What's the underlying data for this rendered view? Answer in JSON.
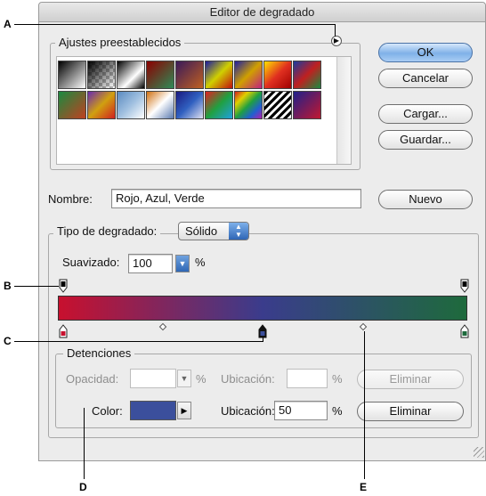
{
  "window": {
    "title": "Editor de degradado"
  },
  "presets": {
    "legend": "Ajustes preestablecidos",
    "swatches": [
      "linear-gradient(135deg,#000,#fff)",
      "linear-gradient(135deg,#000 0%,rgba(0,0,0,0) 100%), repeating-conic-gradient(#bbb 0 25%, #fff 0 50%) 0 0/8px 8px",
      "linear-gradient(135deg,#000,#fff 60%,#000)",
      "linear-gradient(135deg,#8b0000,#2e8b57)",
      "linear-gradient(135deg,#3a1a5a,#c06020)",
      "linear-gradient(135deg,#1a1aa0,#d0d000,#c01010)",
      "linear-gradient(135deg,#2020a0,#d0a000,#c02080)",
      "linear-gradient(135deg,#ffe000,#e03020,#a00000)",
      "linear-gradient(135deg,#1a3aa0,#c02020,#1a8a40)",
      "linear-gradient(135deg,#1a8a40,#c04020)",
      "linear-gradient(135deg,#6a2ab0,#d0a010,#d02020)",
      "linear-gradient(135deg,#5a8ac0,#a0c0e0,#fff)",
      "linear-gradient(135deg,#d07010,#fff 50%,#5a7ab0)",
      "linear-gradient(135deg,#1a1a80,#3060c0,#e0e0f0)",
      "linear-gradient(135deg,#e02020,#20a040,#20a0e0)",
      "linear-gradient(135deg,#d02020,#e0d000,#20a040,#2060d0,#b020b0)",
      "repeating-linear-gradient(135deg,#000 0 3px,#fff 3px 6px)",
      "linear-gradient(135deg,#20208a,#c01830)"
    ]
  },
  "buttons": {
    "ok": "OK",
    "cancel": "Cancelar",
    "load": "Cargar...",
    "save": "Guardar...",
    "new": "Nuevo"
  },
  "name": {
    "label": "Nombre:",
    "value": "Rojo, Azul, Verde"
  },
  "gradient_type": {
    "label": "Tipo de degradado:",
    "value": "Sólido"
  },
  "smoothness": {
    "label": "Suavizado:",
    "value": "100",
    "unit": "%"
  },
  "gradient_bar": {
    "colors": [
      "#c8102e",
      "#3a3c8c",
      "#1e6a3c"
    ]
  },
  "stops": {
    "legend": "Detenciones",
    "opacity_label": "Opacidad:",
    "opacity_value": "",
    "opacity_unit": "%",
    "opacity_location_label": "Ubicación:",
    "opacity_location_value": "",
    "opacity_location_unit": "%",
    "delete_opacity": "Eliminar",
    "color_label": "Color:",
    "color_value": "#3b4f9c",
    "color_location_label": "Ubicación:",
    "color_location_value": "50",
    "color_location_unit": "%",
    "delete_color": "Eliminar"
  },
  "callouts": {
    "a": "A",
    "b": "B",
    "c": "C",
    "d": "D",
    "e": "E"
  }
}
